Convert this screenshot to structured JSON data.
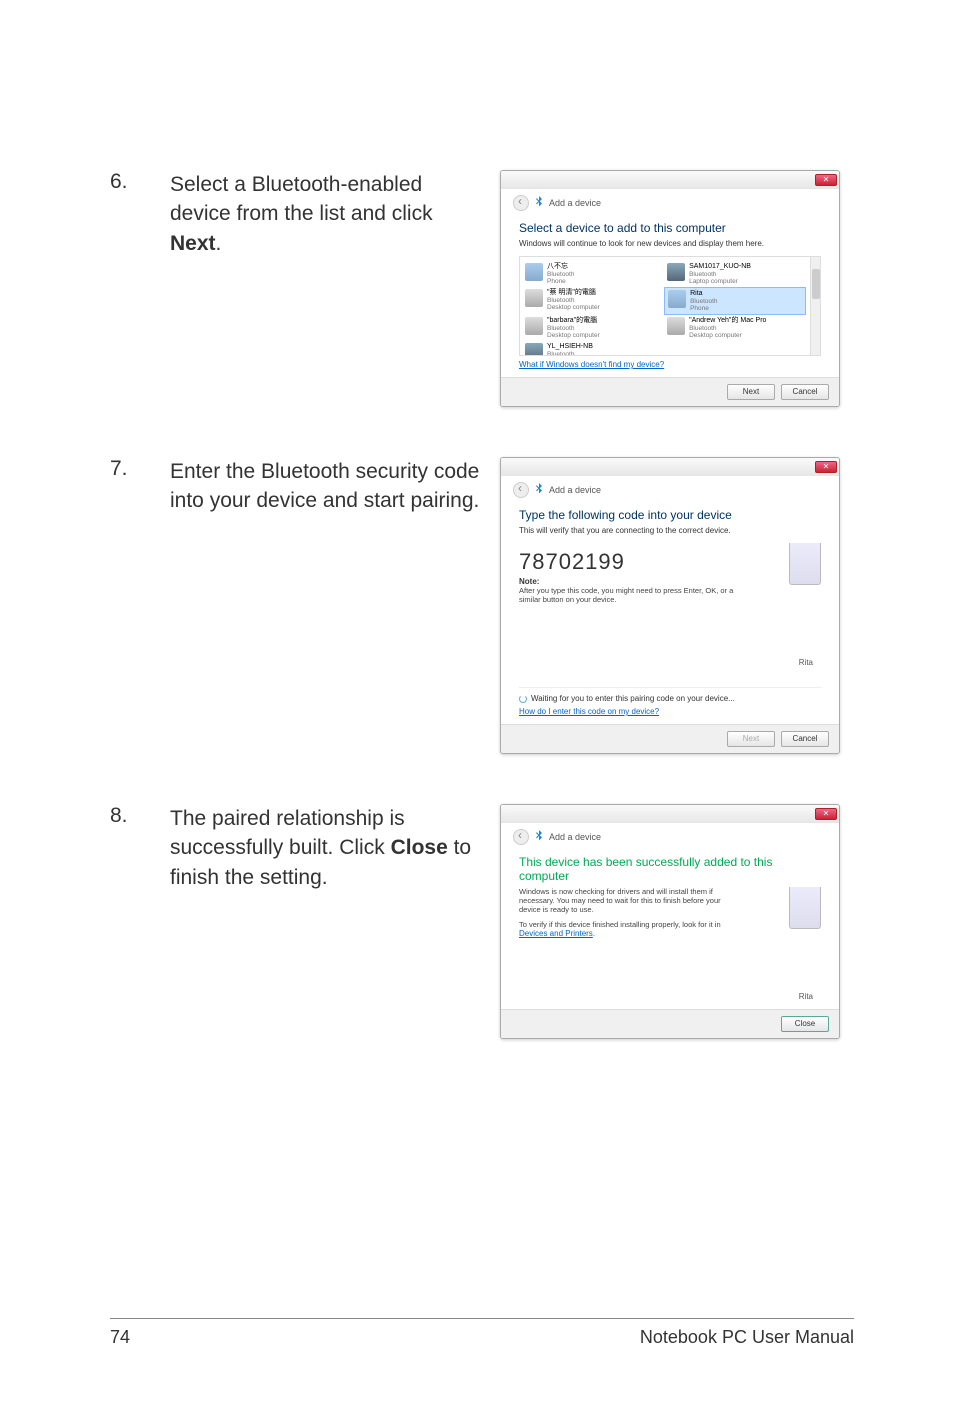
{
  "steps": [
    {
      "num": "6.",
      "text_pre": "Select a Bluetooth-enabled device from the list and click ",
      "text_bold": "Next",
      "text_post": "."
    },
    {
      "num": "7.",
      "text_pre": "Enter the Bluetooth security code into your device and start pairing.",
      "text_bold": "",
      "text_post": ""
    },
    {
      "num": "8.",
      "text_pre": "The paired relationship is successfully built. Click ",
      "text_bold": "Close",
      "text_post": " to finish the setting."
    }
  ],
  "dialogs": {
    "d1": {
      "breadcrumb": "Add a device",
      "title": "Select a device to add to this computer",
      "subtitle": "Windows will continue to look for new devices and display them here.",
      "devices": [
        {
          "name": "八不忘",
          "type": "Bluetooth",
          "cat": "Phone"
        },
        {
          "name": "SAM1017_KUO-NB",
          "type": "Bluetooth",
          "cat": "Laptop computer"
        },
        {
          "name": "\"蔡 明清\"的電腦",
          "type": "Bluetooth",
          "cat": "Desktop computer"
        },
        {
          "name": "Rita",
          "type": "Bluetooth",
          "cat": "Phone",
          "selected": true
        },
        {
          "name": "\"barbara\"的電腦",
          "type": "Bluetooth",
          "cat": "Desktop computer"
        },
        {
          "name": "\"Andrew Yeh\"的 Mac Pro",
          "type": "Bluetooth",
          "cat": "Desktop computer"
        },
        {
          "name": "YL_HSIEH-NB",
          "type": "Bluetooth",
          "cat": ""
        }
      ],
      "link": "What if Windows doesn't find my device?",
      "btn_next": "Next",
      "btn_cancel": "Cancel"
    },
    "d2": {
      "breadcrumb": "Add a device",
      "title": "Type the following code into your device",
      "subtitle": "This will verify that you are connecting to the correct device.",
      "code": "78702199",
      "note_label": "Note:",
      "note_text": "After you type this code, you might need to press Enter, OK, or a similar button on your device.",
      "device_name": "Rita",
      "waiting": "Waiting for you to enter this pairing code on your device...",
      "link": "How do I enter this code on my device?",
      "btn_next": "Next",
      "btn_cancel": "Cancel"
    },
    "d3": {
      "breadcrumb": "Add a device",
      "title": "This device has been successfully added to this computer",
      "body1": "Windows is now checking for drivers and will install them if necessary. You may need to wait for this to finish before your device is ready to use.",
      "body2_pre": "To verify if this device finished installing properly, look for it in ",
      "body2_link": "Devices and Printers",
      "device_name": "Rita",
      "btn_close": "Close"
    }
  },
  "footer": {
    "page": "74",
    "title": "Notebook PC User Manual"
  }
}
